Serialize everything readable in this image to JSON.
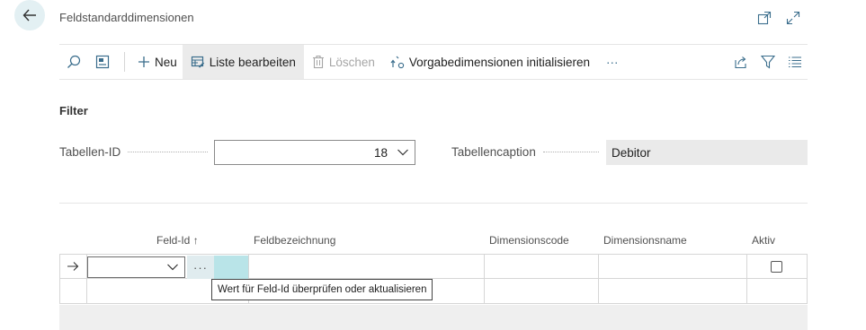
{
  "page": {
    "title": "Feldstandarddimensionen"
  },
  "actionbar": {
    "new_label": "Neu",
    "edit_list_label": "Liste bearbeiten",
    "delete_label": "Löschen",
    "init_label": "Vorgabedimensionen initialisieren",
    "more_label": "···"
  },
  "filter": {
    "heading": "Filter",
    "table_id_label": "Tabellen-ID",
    "table_id_value": "18",
    "table_caption_label": "Tabellencaption",
    "table_caption_value": "Debitor"
  },
  "grid": {
    "columns": [
      "Feld-Id",
      "Feldbezeichnung",
      "Dimensionscode",
      "Dimensionsname",
      "Aktiv"
    ],
    "sort_indicator": "↑",
    "more_cell": "···",
    "tooltip": "Wert für Feld-Id überprüfen oder aktualisieren"
  }
}
